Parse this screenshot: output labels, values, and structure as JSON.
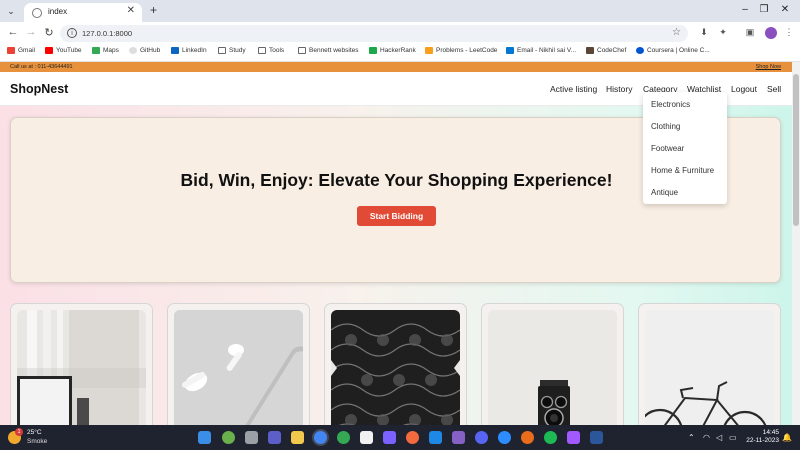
{
  "browser": {
    "tab_title": "index",
    "url": "127.0.0.1:8000",
    "bookmarks": [
      "Gmail",
      "YouTube",
      "Maps",
      "GitHub",
      "LinkedIn",
      "Study",
      "Tools",
      "Bennett websites",
      "HackerRank",
      "Problems - LeetCode",
      "Email - Nikhil sai V...",
      "CodeChef",
      "Coursera | Online C..."
    ]
  },
  "topbar": {
    "call": "Call us at : 011-43644491",
    "shop_now": "Shop Now"
  },
  "navbar": {
    "brand": "ShopNest",
    "items": [
      "Active listing",
      "History",
      "Category",
      "Watchlist",
      "Logout",
      "Sell"
    ]
  },
  "category_menu": [
    "Electronics",
    "Clothing",
    "Footwear",
    "Home & Furniture",
    "Antique"
  ],
  "hero": {
    "headline": "Bid, Win, Enjoy: Elevate Your Shopping Experience!",
    "cta": "Start Bidding"
  },
  "taskbar": {
    "temperature": "25°C",
    "weather": "Smoke",
    "notification_count": "1",
    "time": "14:45",
    "date": "22-11-2023"
  },
  "colors": {
    "accent": "#e14a35",
    "topbar": "#e8913c"
  }
}
